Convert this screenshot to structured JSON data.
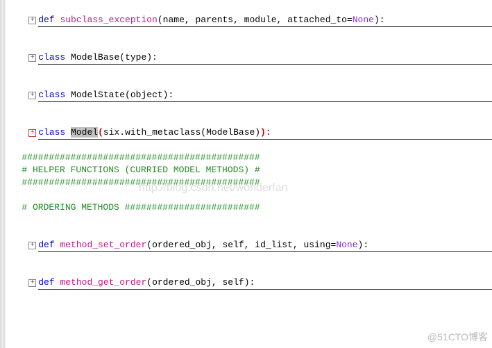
{
  "fold_glyph": "+",
  "lines": {
    "l1": {
      "def": "def",
      "fn": "subclass_exception",
      "args_pre": "(name, parents, module, attached_to=",
      "none": "None",
      "args_post": "):"
    },
    "l2": {
      "cls": "class",
      "name": "ModelBase",
      "tail": "(type):"
    },
    "l3": {
      "cls": "class",
      "name": "ModelState",
      "tail": "(object):"
    },
    "l4": {
      "cls": "class",
      "name_hl": "Model",
      "open": "(",
      "mid": "six.with_metaclass(ModelBase)",
      "close": "):"
    },
    "c1": "############################################",
    "c2": "# HELPER FUNCTIONS (CURRIED MODEL METHODS) #",
    "c3": "############################################",
    "c4": "# ORDERING METHODS #########################",
    "l5": {
      "def": "def",
      "fn": "method_set_order",
      "args_pre": "(ordered_obj, self, id_list, using=",
      "none": "None",
      "args_post": "):"
    },
    "l6": {
      "def": "def",
      "fn": "method_get_order",
      "args": "(ordered_obj, self):"
    }
  },
  "watermark1": "http://blog.csdn.net/wonderfan",
  "watermark2": "@51CTO博客"
}
